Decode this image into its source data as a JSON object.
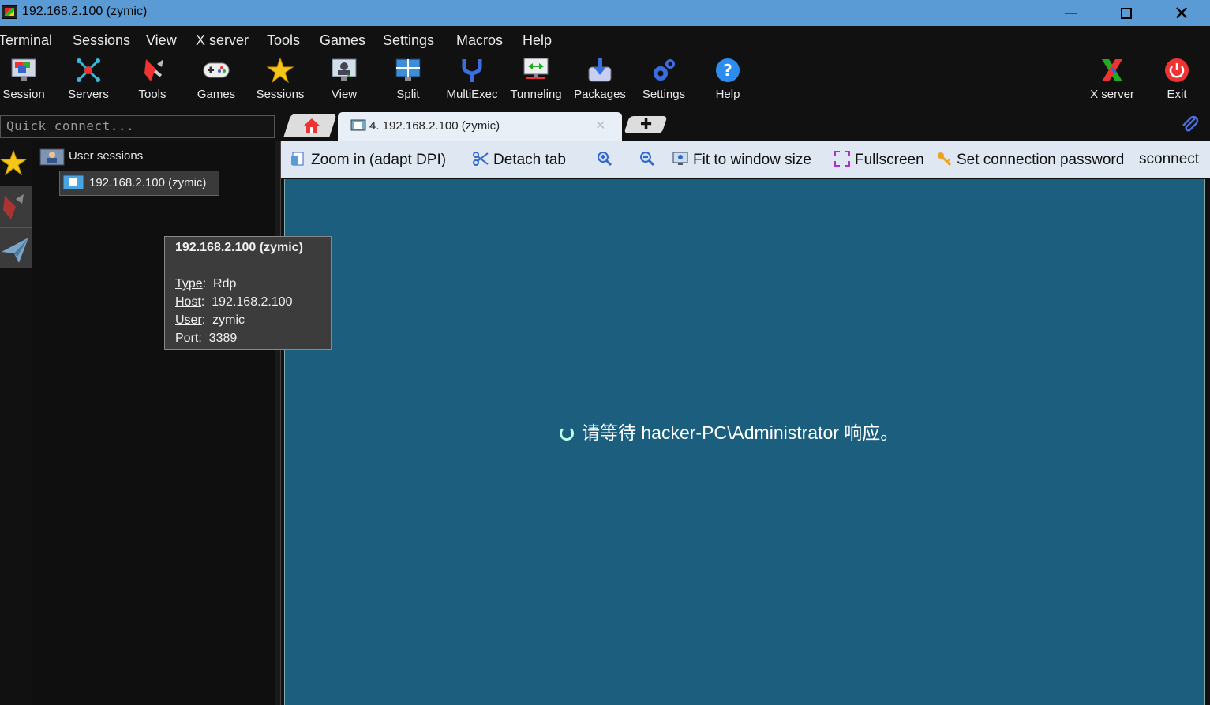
{
  "window": {
    "title": "192.168.2.100 (zymic)"
  },
  "menu": [
    "Terminal",
    "Sessions",
    "View",
    "X server",
    "Tools",
    "Games",
    "Settings",
    "Macros",
    "Help"
  ],
  "toolbar": {
    "session": "Session",
    "servers": "Servers",
    "tools": "Tools",
    "games": "Games",
    "sessions": "Sessions",
    "view": "View",
    "split": "Split",
    "multiexec": "MultiExec",
    "tunneling": "Tunneling",
    "packages": "Packages",
    "settings": "Settings",
    "help": "Help",
    "xserver": "X server",
    "exit": "Exit"
  },
  "quick_connect": {
    "placeholder": "Quick connect..."
  },
  "tabs": {
    "active_label": "4. 192.168.2.100 (zymic)"
  },
  "sidebar": {
    "root_label": "User sessions",
    "items": [
      {
        "label": "192.168.2.100 (zymic)"
      }
    ]
  },
  "tooltip": {
    "title": "192.168.2.100 (zymic)",
    "type_key": "Type",
    "type_value": "Rdp",
    "host_key": "Host",
    "host_value": "192.168.2.100",
    "user_key": "User",
    "user_value": "zymic",
    "port_key": "Port",
    "port_value": "3389"
  },
  "rdp_toolbar": {
    "zoom_in": "Zoom in (adapt DPI)",
    "detach": "Detach tab",
    "fit": "Fit to window size",
    "fullscreen": "Fullscreen",
    "set_password": "Set connection password",
    "reconnect": "sconnect"
  },
  "rdp": {
    "message": "请等待 hacker-PC\\Administrator 响应。"
  },
  "colors": {
    "titlebar": "#5b9bd5",
    "rdp_background": "#1b5e7e",
    "toolbar_bg": "#111111"
  }
}
